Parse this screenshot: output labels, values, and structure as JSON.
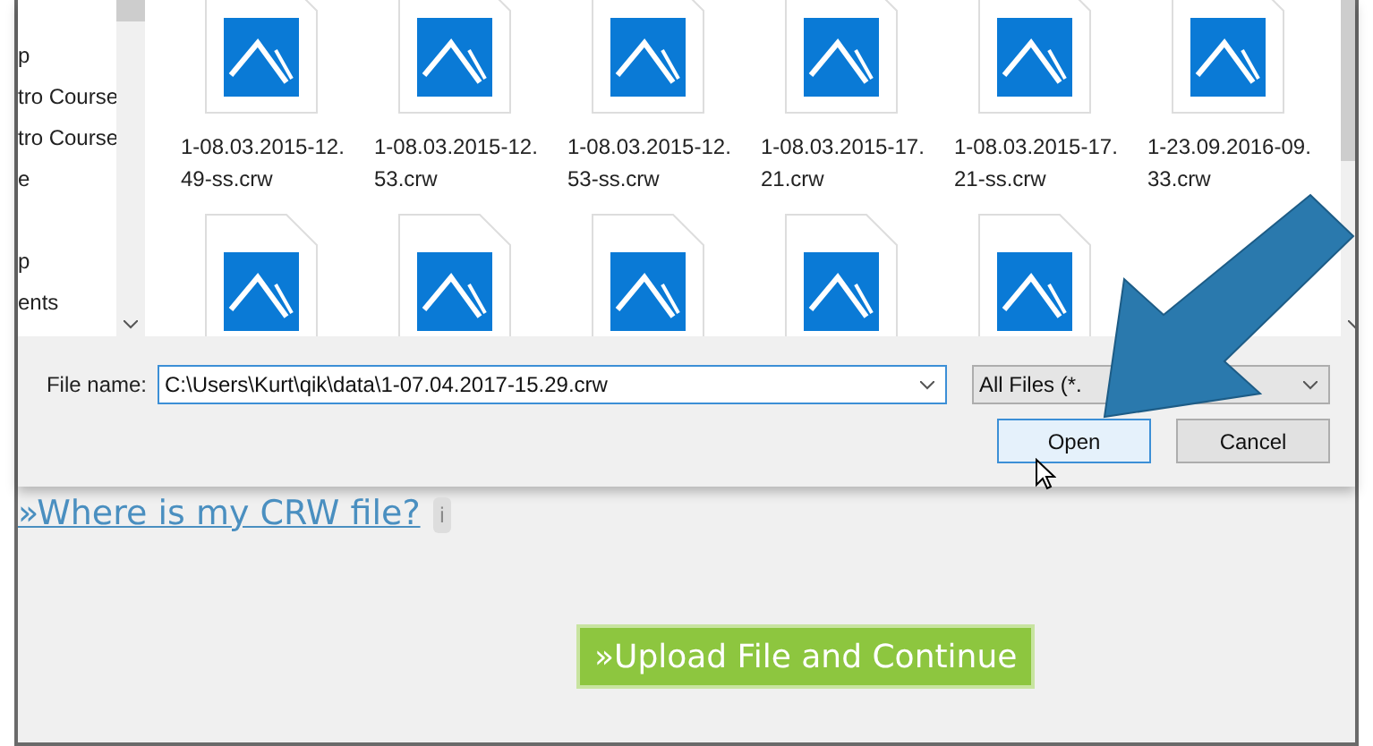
{
  "dialog": {
    "nav_items": [
      "p",
      "tro Course",
      "tro Course",
      "e",
      "p",
      "ents"
    ],
    "files": [
      {
        "name": "1-08.03.2015-12. 49-ss.crw"
      },
      {
        "name": "1-08.03.2015-12. 53.crw"
      },
      {
        "name": "1-08.03.2015-12. 53-ss.crw"
      },
      {
        "name": "1-08.03.2015-17. 21.crw"
      },
      {
        "name": "1-08.03.2015-17. 21-ss.crw"
      },
      {
        "name": "1-23.09.2016-09. 33.crw"
      }
    ],
    "more_files": [
      {
        "kind": "image"
      },
      {
        "kind": "image"
      },
      {
        "kind": "image"
      },
      {
        "kind": "image"
      },
      {
        "kind": "image"
      }
    ],
    "file_name_label": "File name:",
    "file_name_value": "C:\\Users\\Kurt\\qik\\data\\1-07.04.2017-15.29.crw",
    "filter": "All Files (*.",
    "buttons": [
      {
        "label": "Open",
        "selected": true
      },
      {
        "label": "Cancel",
        "selected": false
      }
    ]
  },
  "link": "»Where is my CRW file?",
  "info_badge": "i",
  "upload_button": "»Upload File and Continue"
}
